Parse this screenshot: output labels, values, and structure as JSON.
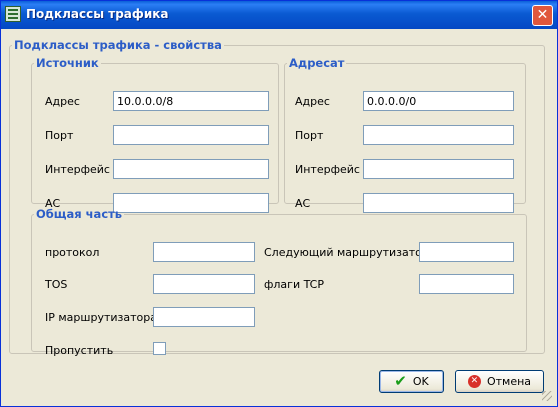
{
  "window": {
    "title": "Подклассы трафика",
    "close_symbol": "✕"
  },
  "main_group": {
    "legend": "Подклассы трафика - свойства"
  },
  "source": {
    "legend": "Источник",
    "address_label": "Адрес",
    "address_value": "10.0.0.0/8",
    "port_label": "Порт",
    "port_value": "",
    "interface_label": "Интерфейс",
    "interface_value": "",
    "as_label": "АС",
    "as_value": ""
  },
  "destination": {
    "legend": "Адресат",
    "address_label": "Адрес",
    "address_value": "0.0.0.0/0",
    "port_label": "Порт",
    "port_value": "",
    "interface_label": "Интерфейс",
    "interface_value": "",
    "as_label": "АС",
    "as_value": ""
  },
  "common": {
    "legend": "Общая часть",
    "protocol_label": "протокол",
    "protocol_value": "",
    "tos_label": "TOS",
    "tos_value": "",
    "router_ip_label": "IP маршрутизатора",
    "router_ip_value": "",
    "skip_label": "Пропустить",
    "skip_checked": false,
    "next_hop_label": "Следующий маршрутизатор",
    "next_hop_value": "",
    "tcp_flags_label": "флаги TCP",
    "tcp_flags_value": ""
  },
  "buttons": {
    "ok_label": "OK",
    "cancel_label": "Отмена"
  },
  "icons": {
    "ok": "checkmark-icon",
    "cancel": "cancel-icon",
    "app": "app-icon",
    "close": "close-icon"
  }
}
